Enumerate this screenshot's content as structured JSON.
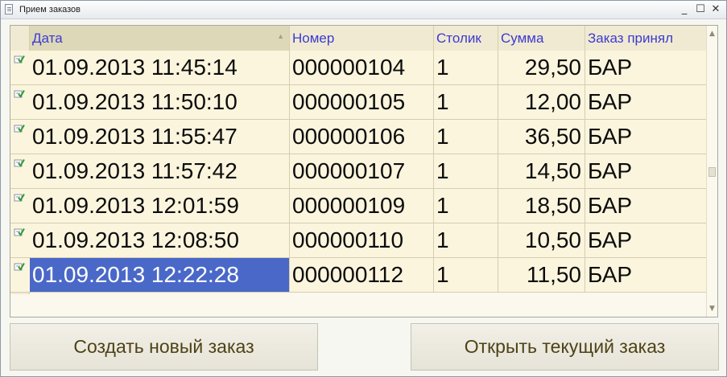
{
  "window": {
    "title": "Прием заказов"
  },
  "window_controls": {
    "minimize": "_",
    "maximize": "☐",
    "close": "✕"
  },
  "table": {
    "columns": [
      "Дата",
      "Номер",
      "Столик",
      "Сумма",
      "Заказ принял"
    ],
    "sort_indicator": "▲",
    "rows": [
      {
        "date": "01.09.2013 11:45:14",
        "number": "000000104",
        "table": "1",
        "sum": "29,50",
        "taker": "БАР"
      },
      {
        "date": "01.09.2013 11:50:10",
        "number": "000000105",
        "table": "1",
        "sum": "12,00",
        "taker": "БАР"
      },
      {
        "date": "01.09.2013 11:55:47",
        "number": "000000106",
        "table": "1",
        "sum": "36,50",
        "taker": "БАР"
      },
      {
        "date": "01.09.2013 11:57:42",
        "number": "000000107",
        "table": "1",
        "sum": "14,50",
        "taker": "БАР"
      },
      {
        "date": "01.09.2013 12:01:59",
        "number": "000000109",
        "table": "1",
        "sum": "18,50",
        "taker": "БАР"
      },
      {
        "date": "01.09.2013 12:08:50",
        "number": "000000110",
        "table": "1",
        "sum": "10,50",
        "taker": "БАР"
      },
      {
        "date": "01.09.2013 12:22:28",
        "number": "000000112",
        "table": "1",
        "sum": "11,50",
        "taker": "БАР"
      }
    ],
    "selected_row": 6
  },
  "buttons": {
    "create": "Создать новый заказ",
    "open": "Открыть текущий заказ"
  },
  "scroll": {
    "up": "▲",
    "down": "▼"
  },
  "colors": {
    "accent_text": "#3b3bd0",
    "selection": "#4a68c8",
    "row_bg": "#fbf5de",
    "button_text": "#4e4217"
  },
  "icons": {
    "row_status": "document-check-icon"
  }
}
